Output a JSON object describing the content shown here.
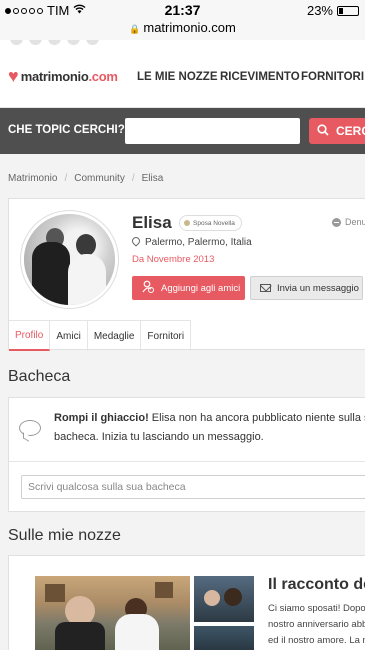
{
  "status_bar": {
    "carrier": "TIM",
    "time": "21:37",
    "battery": "23%",
    "battery_level": 0.23
  },
  "browser": {
    "url": "matrimonio.com"
  },
  "header": {
    "logo": {
      "prefix": "matrimonio",
      "suffix": ".com"
    },
    "nav": [
      "LE MIE NOZZE",
      "RICEVIMENTO",
      "FORNITORI"
    ]
  },
  "search": {
    "label": "CHE TOPIC CERCHI?",
    "placeholder": "",
    "button": "CERCA"
  },
  "breadcrumb": [
    "Matrimonio",
    "Community",
    "Elisa"
  ],
  "profile": {
    "name": "Elisa",
    "badge": "Sposa Novella",
    "report": "Denuncia",
    "location": "Palermo, Palermo, Italia",
    "since": "Da Novembre 2013",
    "add_friend": "Aggiungi agli amici",
    "send_message": "Invia un messaggio",
    "tabs": [
      "Profilo",
      "Amici",
      "Medaglie",
      "Fornitori"
    ]
  },
  "wall": {
    "title": "Bacheca",
    "lead": "Rompi il ghiaccio!",
    "text": " Elisa non ha ancora pubblicato niente sulla sua bacheca. Inizia tu lasciando un messaggio.",
    "write_placeholder": "Scrivi qualcosa sulla sua bacheca"
  },
  "wedding": {
    "title": "Sulle mie nozze",
    "story_title": "Il racconto del",
    "story_lines": [
      "Ci siamo sposati! Dopo",
      "nostro anniversario abb",
      "ed il nostro amore. La n"
    ]
  }
}
